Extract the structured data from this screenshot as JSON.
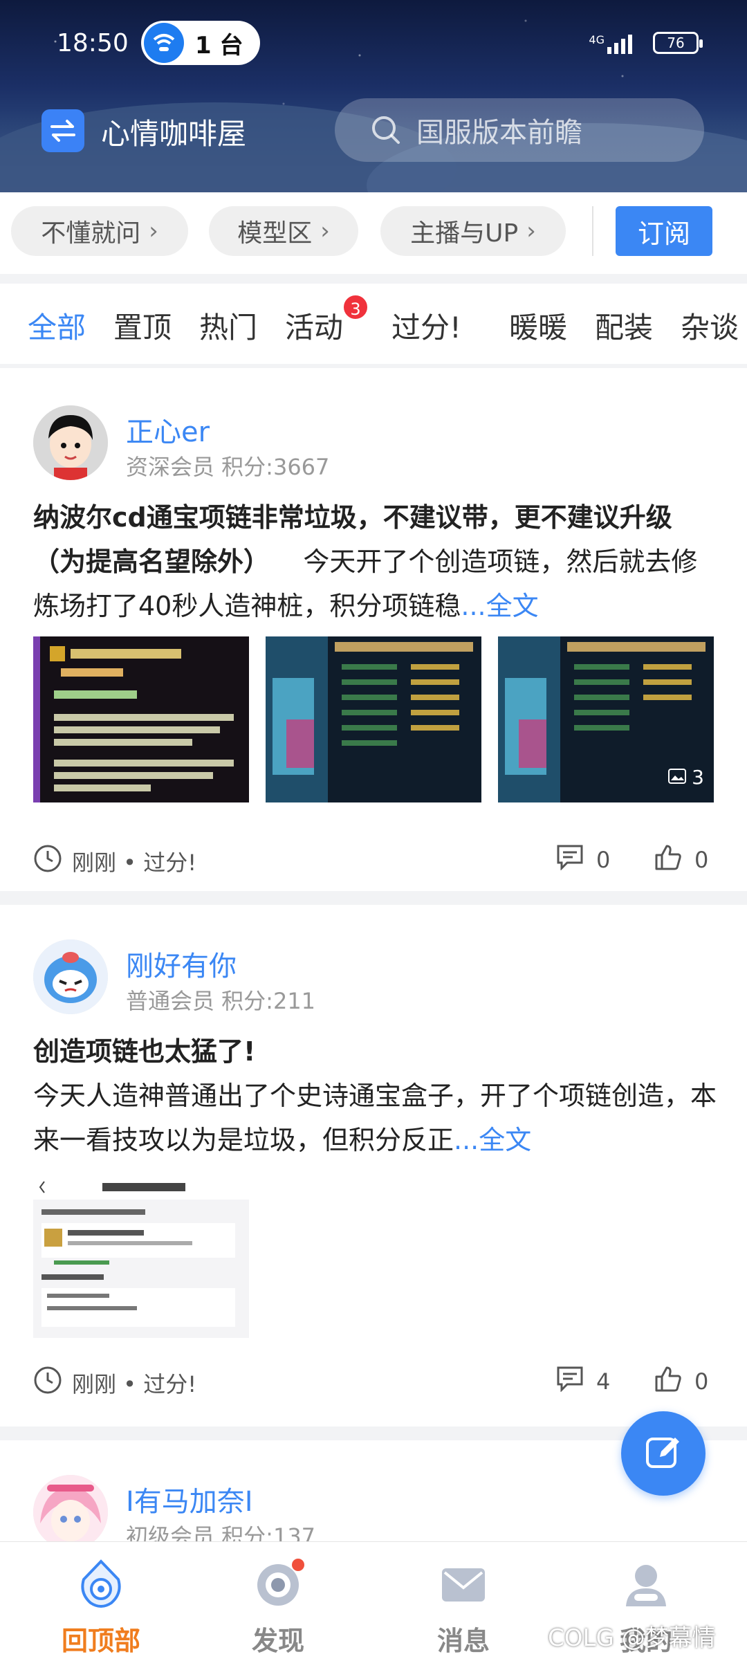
{
  "status_bar": {
    "time": "18:50",
    "device_pill": "1 台",
    "network": "4G",
    "battery": "76"
  },
  "header": {
    "forum_name": "心情咖啡屋",
    "search_placeholder": "国服版本前瞻"
  },
  "shortcuts": {
    "chips": [
      {
        "label": "不懂就问"
      },
      {
        "label": "模型区"
      },
      {
        "label": "主播与UP"
      }
    ],
    "subscribe_label": "订阅"
  },
  "tabs": {
    "items": [
      {
        "label": "全部"
      },
      {
        "label": "置顶"
      },
      {
        "label": "热门"
      },
      {
        "label": "活动"
      },
      {
        "label": "过分!"
      },
      {
        "label": "暖暖"
      },
      {
        "label": "配装"
      },
      {
        "label": "杂谈"
      }
    ],
    "activity_badge": "3"
  },
  "posts": [
    {
      "username": "正心er",
      "meta": "资深会员  积分:3667",
      "title": "纳波尔cd通宝项链非常垃圾，不建议带，更不建议升级（为提高名望除外）",
      "body": "今天开了个创造项链，然后就去修炼场打了40秒人造神桩，积分项链稳",
      "more": "...全文",
      "image_count": "3",
      "time_tag": "刚刚 • 过分!",
      "comments": "0",
      "likes": "0"
    },
    {
      "username": "刚好有你",
      "meta": "普通会员  积分:211",
      "title": "创造项链也太猛了!",
      "body": "今天人造神普通出了个史诗通宝盒子，开了个项链创造，本来一看技攻以为是垃圾，但积分反正",
      "more": "...全文",
      "time_tag": "刚刚 • 过分!",
      "comments": "4",
      "likes": "0"
    },
    {
      "username": "I有马加奈I",
      "meta": "初级会员  积分:137"
    }
  ],
  "bottom_nav": [
    {
      "label": "回顶部"
    },
    {
      "label": "发现"
    },
    {
      "label": "消息"
    },
    {
      "label": "我的"
    }
  ],
  "watermark": "COLG @梦幕情",
  "colors": {
    "accent": "#3b87f4",
    "active_nav": "#f07d1e",
    "badge": "#f0323c"
  }
}
